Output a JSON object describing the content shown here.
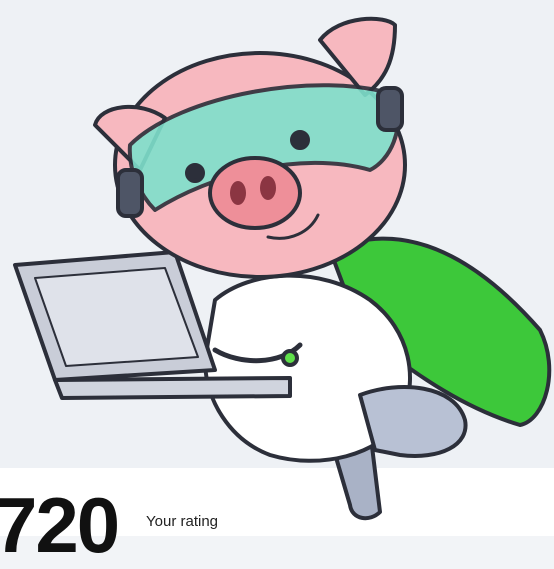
{
  "profile": {
    "rating_value": "720",
    "rating_label": "Your rating"
  },
  "mascot": {
    "name": "pig-with-laptop-mascot",
    "colors": {
      "skin": "#f7b8bf",
      "snout": "#ee8f99",
      "goggles": "#7fe0cc",
      "cape": "#3dc83a",
      "suit": "#ffffff",
      "laptop": "#c9cdd8",
      "outline": "#2c2f3a"
    }
  }
}
